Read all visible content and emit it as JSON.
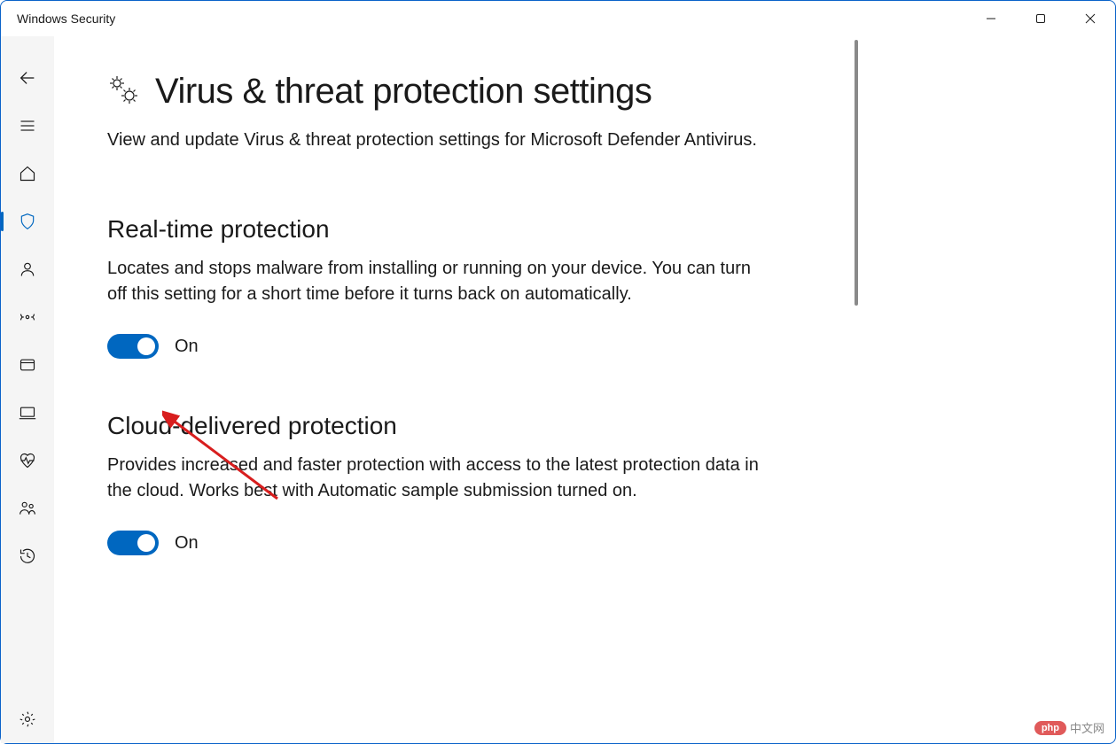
{
  "window": {
    "title": "Windows Security"
  },
  "page": {
    "title": "Virus & threat protection settings",
    "subtitle": "View and update Virus & threat protection settings for Microsoft Defender Antivirus."
  },
  "sections": {
    "realtime": {
      "title": "Real-time protection",
      "desc": "Locates and stops malware from installing or running on your device. You can turn off this setting for a short time before it turns back on automatically.",
      "toggle_state": "On"
    },
    "cloud": {
      "title": "Cloud-delivered protection",
      "desc": "Provides increased and faster protection with access to the latest protection data in the cloud. Works best with Automatic sample submission turned on.",
      "toggle_state": "On"
    }
  },
  "sidebar": {
    "items": [
      {
        "name": "back"
      },
      {
        "name": "menu"
      },
      {
        "name": "home"
      },
      {
        "name": "virus-threat",
        "active": true
      },
      {
        "name": "account"
      },
      {
        "name": "firewall"
      },
      {
        "name": "app-browser"
      },
      {
        "name": "device-security"
      },
      {
        "name": "device-performance"
      },
      {
        "name": "family"
      },
      {
        "name": "history"
      },
      {
        "name": "settings"
      }
    ]
  },
  "watermark": {
    "badge": "php",
    "text": "中文网"
  }
}
